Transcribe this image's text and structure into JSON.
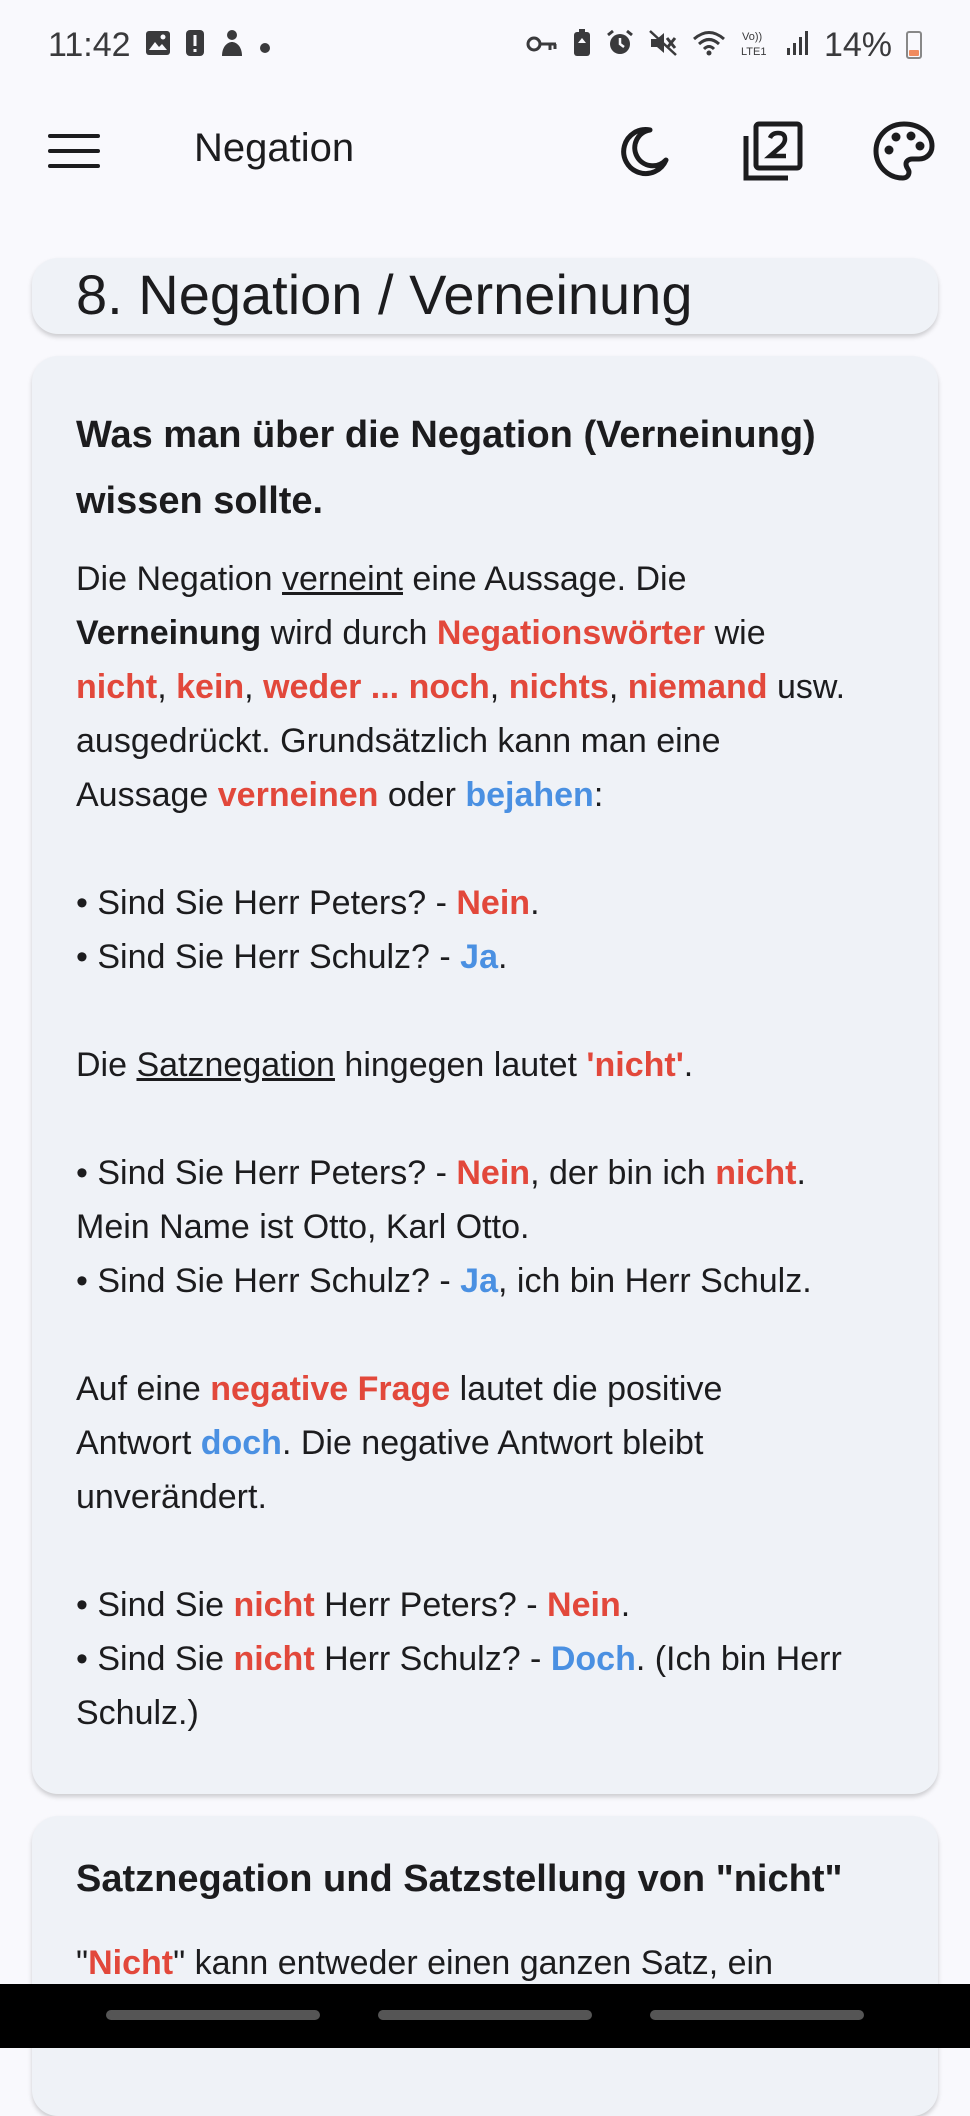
{
  "status_bar": {
    "time": "11:42",
    "battery": "14%",
    "left_icons": [
      "image-icon",
      "alert-icon",
      "person-icon",
      "dot-icon"
    ],
    "right_icons": [
      "key-icon",
      "battery-saver-icon",
      "alarm-icon",
      "mute-icon",
      "wifi-icon",
      "volte-icon",
      "signal-icon"
    ]
  },
  "app_bar": {
    "title": "Negation",
    "actions": [
      "dark-mode-icon",
      "level-2-icon",
      "palette-icon"
    ]
  },
  "chapter": {
    "title": "8. Negation / Verneinung"
  },
  "content": {
    "heading_line1": "Was man über die Negation (Verneinung)",
    "heading_line2": "wissen sollte.",
    "p1": {
      "a": "Die Negation ",
      "b": "verneint",
      "c": " eine Aussage. Die",
      "d": "Verneinung",
      "e": " wird durch ",
      "f": "Negationswörter",
      "g": " wie",
      "h": "nicht",
      "i": ", ",
      "j": "kein",
      "k": ", ",
      "l": "weder ... noch",
      "m": ", ",
      "n": "nichts",
      "o": ", ",
      "p": "niemand",
      "q": " usw.",
      "r": "ausgedrückt. Grundsätzlich kann man eine",
      "s": "Aussage ",
      "t": "verneinen",
      "u": " oder ",
      "v": "bejahen",
      "w": ":"
    },
    "ex1": {
      "a1": "• Sind Sie Herr Peters? - ",
      "a2": "Nein",
      "a3": ".",
      "b1": "• Sind Sie Herr Schulz? - ",
      "b2": "Ja",
      "b3": "."
    },
    "p2": {
      "a": "Die ",
      "b": "Satznegation",
      "c": " hingegen lautet ",
      "d": "'nicht'",
      "e": "."
    },
    "ex2": {
      "a1": "• Sind Sie Herr Peters? - ",
      "a2": "Nein",
      "a3": ", der bin ich ",
      "a4": "nicht",
      "a5": ".",
      "a6": "Mein Name ist Otto, Karl Otto.",
      "b1": "• Sind Sie Herr Schulz? - ",
      "b2": "Ja",
      "b3": ", ich bin Herr Schulz."
    },
    "p3": {
      "a": "Auf eine ",
      "b": "negative Frage",
      "c": " lautet die positive",
      "d": "Antwort ",
      "e": "doch",
      "f": ". Die negative Antwort bleibt",
      "g": "unverändert."
    },
    "ex3": {
      "a1": "• Sind Sie ",
      "a2": "nicht",
      "a3": " Herr Peters? - ",
      "a4": "Nein",
      "a5": ".",
      "b1": "• Sind Sie ",
      "b2": "nicht",
      "b3": " Herr Schulz? - ",
      "b4": "Doch",
      "b5": ". (Ich bin Herr",
      "b6": "Schulz.)"
    }
  },
  "section2": {
    "heading": "Satznegation und Satzstellung von \"nicht\"",
    "text_a": "\"",
    "text_b": "Nicht",
    "text_c": "\" kann entweder einen ganzen Satz, ein"
  },
  "colors": {
    "red": "#e2483b",
    "blue": "#4a90e2",
    "card": "#eff2f7",
    "background": "#f9f9fd"
  }
}
